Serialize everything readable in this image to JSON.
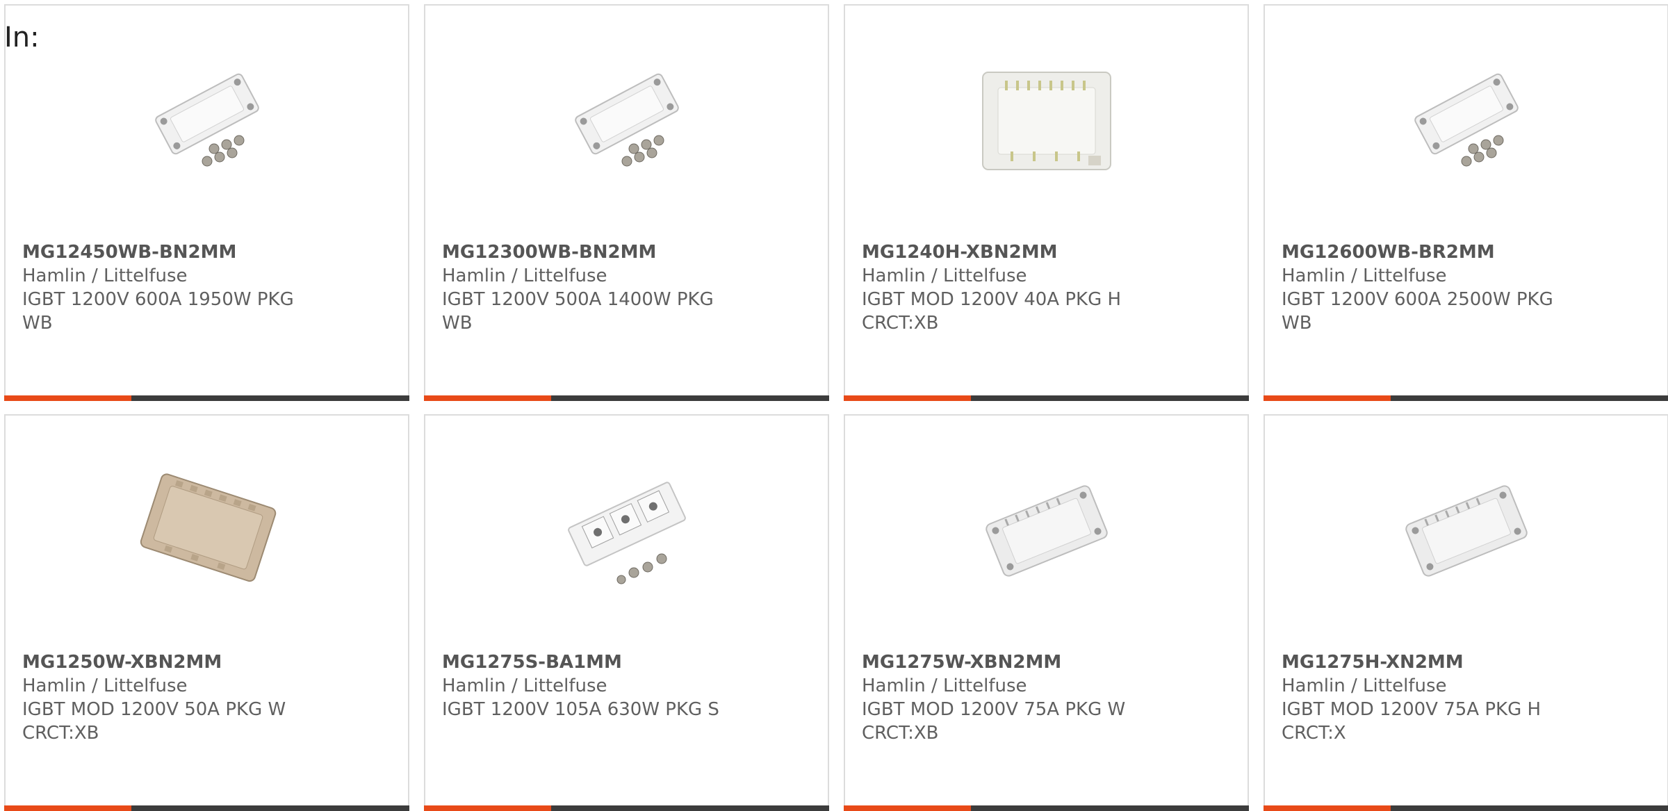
{
  "header": {
    "in_label": "In:"
  },
  "colors": {
    "accent": "#e84a18",
    "bar": "#3c3c3c",
    "text": "#5f5f5f",
    "border": "#dcdcdc"
  },
  "products": [
    {
      "part_number": "MG12450WB-BN2MM",
      "manufacturer": "Hamlin / Littelfuse",
      "description": "IGBT 1200V 600A 1950W PKG WB",
      "image_icon": "igbt-module-wb-image"
    },
    {
      "part_number": "MG12300WB-BN2MM",
      "manufacturer": "Hamlin / Littelfuse",
      "description": "IGBT 1200V 500A 1400W PKG WB",
      "image_icon": "igbt-module-wb-image"
    },
    {
      "part_number": "MG1240H-XBN2MM",
      "manufacturer": "Hamlin / Littelfuse",
      "description": "IGBT MOD 1200V 40A PKG H CRCT:XB",
      "image_icon": "igbt-module-h-image"
    },
    {
      "part_number": "MG12600WB-BR2MM",
      "manufacturer": "Hamlin / Littelfuse",
      "description": "IGBT 1200V 600A 2500W PKG WB",
      "image_icon": "igbt-module-wb-image"
    },
    {
      "part_number": "MG1250W-XBN2MM",
      "manufacturer": "Hamlin / Littelfuse",
      "description": "IGBT MOD 1200V 50A PKG W CRCT:XB",
      "image_icon": "igbt-module-w-image"
    },
    {
      "part_number": "MG1275S-BA1MM",
      "manufacturer": "Hamlin / Littelfuse",
      "description": "IGBT 1200V 105A 630W PKG S",
      "image_icon": "igbt-module-s-image"
    },
    {
      "part_number": "MG1275W-XBN2MM",
      "manufacturer": "Hamlin / Littelfuse",
      "description": "IGBT MOD 1200V 75A PKG W CRCT:XB",
      "image_icon": "igbt-module-w-image"
    },
    {
      "part_number": "MG1275H-XN2MM",
      "manufacturer": "Hamlin / Littelfuse",
      "description": "IGBT MOD 1200V 75A PKG H CRCT:X",
      "image_icon": "igbt-module-h-image"
    }
  ]
}
